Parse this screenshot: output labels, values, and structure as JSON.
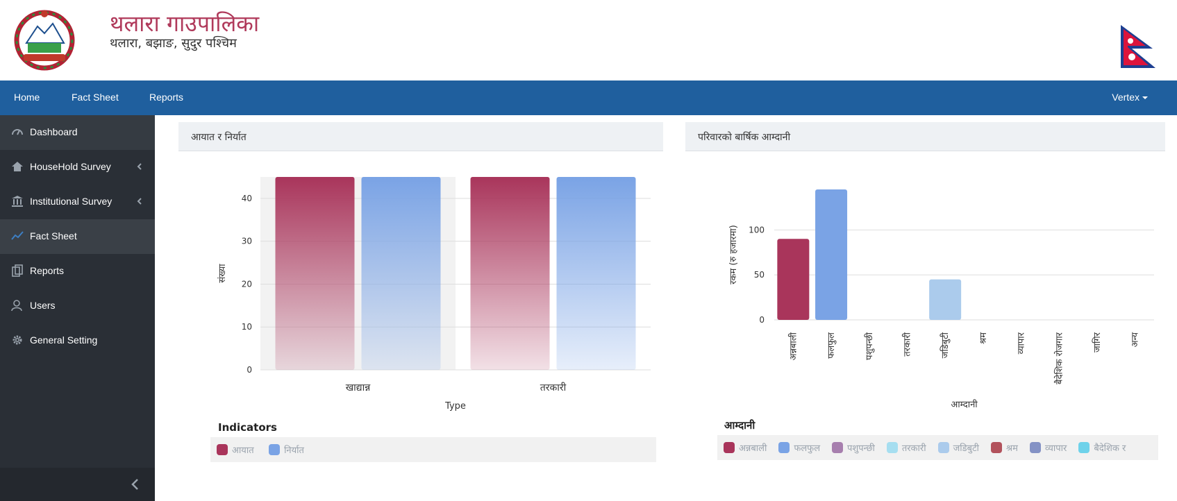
{
  "header": {
    "title": "थलारा गाउपालिका",
    "subtitle": "थलारा, बझाङ, सुदुर पश्चिम"
  },
  "nav": {
    "links": [
      "Home",
      "Fact Sheet",
      "Reports"
    ],
    "user": "Vertex"
  },
  "sidebar": {
    "items": [
      {
        "label": "Dashboard",
        "icon": "dashboard-icon"
      },
      {
        "label": "HouseHold Survey",
        "icon": "home-icon"
      },
      {
        "label": "Institutional Survey",
        "icon": "bank-icon"
      },
      {
        "label": "Fact Sheet",
        "icon": "line-chart-icon"
      },
      {
        "label": "Reports",
        "icon": "copy-icon"
      },
      {
        "label": "Users",
        "icon": "user-icon"
      },
      {
        "label": "General Setting",
        "icon": "gear-icon"
      }
    ]
  },
  "panels": {
    "left_title": "आयात र निर्यात",
    "right_title": "परिवारको बार्षिक आम्दानी"
  },
  "colors": {
    "accent": "#1f5f9e",
    "crimson": "#a9355b",
    "blue": "#7aa3e5"
  },
  "chart_data": [
    {
      "type": "bar",
      "title": "",
      "xlabel": "Type",
      "ylabel": "संख्या",
      "categories": [
        "खाद्यान्न",
        "तरकारी"
      ],
      "series": [
        {
          "name": "आयात",
          "values": [
            45,
            45
          ],
          "color": "#a9355b"
        },
        {
          "name": "निर्यात",
          "values": [
            45,
            45
          ],
          "color": "#7aa3e5"
        }
      ],
      "ylim": [
        0,
        45
      ],
      "yticks": [
        0,
        10,
        20,
        30,
        40
      ],
      "grid": true,
      "legend_title": "Indicators",
      "legend_position": "bottom"
    },
    {
      "type": "bar",
      "title": "",
      "xlabel": "आम्दानी",
      "ylabel": "रकम (रु हजारमा)",
      "categories": [
        "अन्नबाली",
        "फलफुल",
        "पशुपन्छी",
        "तरकारी",
        "जडिबुटी",
        "श्रम",
        "व्यापार",
        "बैदेशिक रोजगार",
        "जागिर",
        "अन्य"
      ],
      "values": [
        90,
        145,
        0,
        0,
        45,
        0,
        0,
        0,
        0,
        0
      ],
      "ylim": [
        0,
        145
      ],
      "yticks": [
        0,
        50,
        100
      ],
      "grid": true,
      "legend_title": "आम्दानी",
      "legend": [
        {
          "name": "अन्नबाली",
          "color": "#a9355b"
        },
        {
          "name": "फलफुल",
          "color": "#7aa3e5"
        },
        {
          "name": "पशुपन्छी",
          "color": "#a77fae"
        },
        {
          "name": "तरकारी",
          "color": "#a6def0"
        },
        {
          "name": "जडिबुटी",
          "color": "#abcbec"
        },
        {
          "name": "श्रम",
          "color": "#b2525c"
        },
        {
          "name": "व्यापार",
          "color": "#8492c5"
        },
        {
          "name": "बैदेशिक र",
          "color": "#6ed2ea"
        }
      ],
      "legend_position": "bottom"
    }
  ]
}
